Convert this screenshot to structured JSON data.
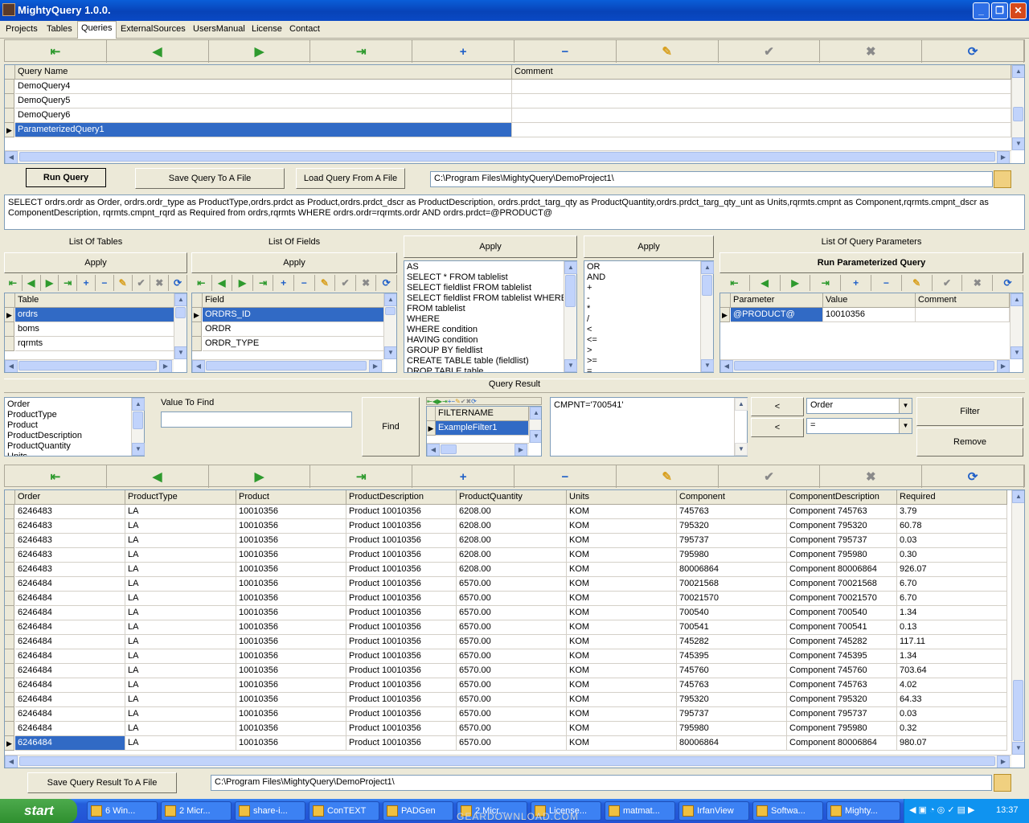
{
  "window": {
    "title": "MightyQuery 1.0.0."
  },
  "menu": [
    "Projects",
    "Tables",
    "Queries",
    "ExternalSources",
    "UsersManual",
    "License",
    "Contact"
  ],
  "queries": {
    "columns": [
      "Query Name",
      "Comment"
    ],
    "rows": [
      "DemoQuery4",
      "DemoQuery5",
      "DemoQuery6",
      "ParameterizedQuery1"
    ]
  },
  "buttons": {
    "run_query": "Run Query",
    "save_query": "Save Query To A File",
    "load_query": "Load Query From A File",
    "find": "Find",
    "filter": "Filter",
    "remove": "Remove",
    "save_result": "Save Query Result To A File",
    "run_param": "Run Parameterized Query",
    "apply": "Apply",
    "lt": "<"
  },
  "project_path": "C:\\Program Files\\MightyQuery\\DemoProject1\\",
  "sql_text": "SELECT ordrs.ordr as Order, ordrs.ordr_type as ProductType,ordrs.prdct as Product,ordrs.prdct_dscr as ProductDescription, ordrs.prdct_targ_qty as ProductQuantity,ordrs.prdct_targ_qty_unt as Units,rqrmts.cmpnt as Component,rqrmts.cmpnt_dscr as ComponentDescription, rqrmts.cmpnt_rqrd as Required from ordrs,rqrmts WHERE ordrs.ordr=rqrmts.ordr AND ordrs.prdct=@PRODUCT@",
  "labels": {
    "list_tables": "List Of Tables",
    "list_fields": "List Of Fields",
    "list_params": "List Of Query Parameters",
    "query_result": "Query Result",
    "value_to_find": "Value To Find"
  },
  "tables": {
    "header": "Table",
    "rows": [
      "ordrs",
      "boms",
      "rqrmts"
    ]
  },
  "fields": {
    "header": "Field",
    "rows": [
      "ORDRS_ID",
      "ORDR",
      "ORDR_TYPE"
    ]
  },
  "sql_snippets": [
    "AS",
    "SELECT * FROM tablelist",
    "SELECT fieldlist FROM tablelist",
    "SELECT fieldlist FROM tablelist WHERE co",
    "FROM tablelist",
    "WHERE",
    "WHERE condition",
    "HAVING condition",
    "GROUP BY fieldlist",
    "CREATE TABLE table (fieldlist)",
    "DROP TABLE table"
  ],
  "operators": [
    "OR",
    "AND",
    "+",
    "-",
    "*",
    "/",
    "<",
    "<=",
    ">",
    ">=",
    "="
  ],
  "params": {
    "columns": [
      "Parameter",
      "Value",
      "Comment"
    ],
    "rows": [
      [
        "@PRODUCT@",
        "10010356",
        ""
      ]
    ]
  },
  "result_fields": [
    "Order",
    "ProductType",
    "Product",
    "ProductDescription",
    "ProductQuantity",
    "Units"
  ],
  "filters": {
    "header": "FILTERNAME",
    "rows": [
      "ExampleFilter1"
    ]
  },
  "filter_expr": "CMPNT='700541'",
  "filter_combo1": "Order",
  "filter_combo2": "=",
  "result": {
    "columns": [
      "Order",
      "ProductType",
      "Product",
      "ProductDescription",
      "ProductQuantity",
      "Units",
      "Component",
      "ComponentDescription",
      "Required"
    ],
    "rows": [
      [
        "6246483",
        "LA",
        "10010356",
        "Product 10010356",
        "6208.00",
        "KOM",
        "745763",
        "Component 745763",
        "3.79"
      ],
      [
        "6246483",
        "LA",
        "10010356",
        "Product 10010356",
        "6208.00",
        "KOM",
        "795320",
        "Component 795320",
        "60.78"
      ],
      [
        "6246483",
        "LA",
        "10010356",
        "Product 10010356",
        "6208.00",
        "KOM",
        "795737",
        "Component 795737",
        "0.03"
      ],
      [
        "6246483",
        "LA",
        "10010356",
        "Product 10010356",
        "6208.00",
        "KOM",
        "795980",
        "Component 795980",
        "0.30"
      ],
      [
        "6246483",
        "LA",
        "10010356",
        "Product 10010356",
        "6208.00",
        "KOM",
        "80006864",
        "Component 80006864",
        "926.07"
      ],
      [
        "6246484",
        "LA",
        "10010356",
        "Product 10010356",
        "6570.00",
        "KOM",
        "70021568",
        "Component 70021568",
        "6.70"
      ],
      [
        "6246484",
        "LA",
        "10010356",
        "Product 10010356",
        "6570.00",
        "KOM",
        "70021570",
        "Component 70021570",
        "6.70"
      ],
      [
        "6246484",
        "LA",
        "10010356",
        "Product 10010356",
        "6570.00",
        "KOM",
        "700540",
        "Component 700540",
        "1.34"
      ],
      [
        "6246484",
        "LA",
        "10010356",
        "Product 10010356",
        "6570.00",
        "KOM",
        "700541",
        "Component 700541",
        "0.13"
      ],
      [
        "6246484",
        "LA",
        "10010356",
        "Product 10010356",
        "6570.00",
        "KOM",
        "745282",
        "Component 745282",
        "117.11"
      ],
      [
        "6246484",
        "LA",
        "10010356",
        "Product 10010356",
        "6570.00",
        "KOM",
        "745395",
        "Component 745395",
        "1.34"
      ],
      [
        "6246484",
        "LA",
        "10010356",
        "Product 10010356",
        "6570.00",
        "KOM",
        "745760",
        "Component 745760",
        "703.64"
      ],
      [
        "6246484",
        "LA",
        "10010356",
        "Product 10010356",
        "6570.00",
        "KOM",
        "745763",
        "Component 745763",
        "4.02"
      ],
      [
        "6246484",
        "LA",
        "10010356",
        "Product 10010356",
        "6570.00",
        "KOM",
        "795320",
        "Component 795320",
        "64.33"
      ],
      [
        "6246484",
        "LA",
        "10010356",
        "Product 10010356",
        "6570.00",
        "KOM",
        "795737",
        "Component 795737",
        "0.03"
      ],
      [
        "6246484",
        "LA",
        "10010356",
        "Product 10010356",
        "6570.00",
        "KOM",
        "795980",
        "Component 795980",
        "0.32"
      ],
      [
        "6246484",
        "LA",
        "10010356",
        "Product 10010356",
        "6570.00",
        "KOM",
        "80006864",
        "Component 80006864",
        "980.07"
      ]
    ]
  },
  "result_path": "C:\\Program Files\\MightyQuery\\DemoProject1\\",
  "taskbar": {
    "start": "start",
    "items": [
      "6 Win...",
      "2 Micr...",
      "share-i...",
      "ConTEXT",
      "PADGen",
      "2 Micr...",
      "License...",
      "matmat...",
      "IrfanView",
      "Softwa...",
      "Mighty..."
    ],
    "clock": "13:37"
  },
  "watermark": "GEARDOWNLOAD.COM",
  "nav_glyphs": [
    "⇤",
    "◀",
    "▶",
    "⇥",
    "+",
    "−",
    "✎",
    "✔",
    "✖",
    "⟳"
  ]
}
